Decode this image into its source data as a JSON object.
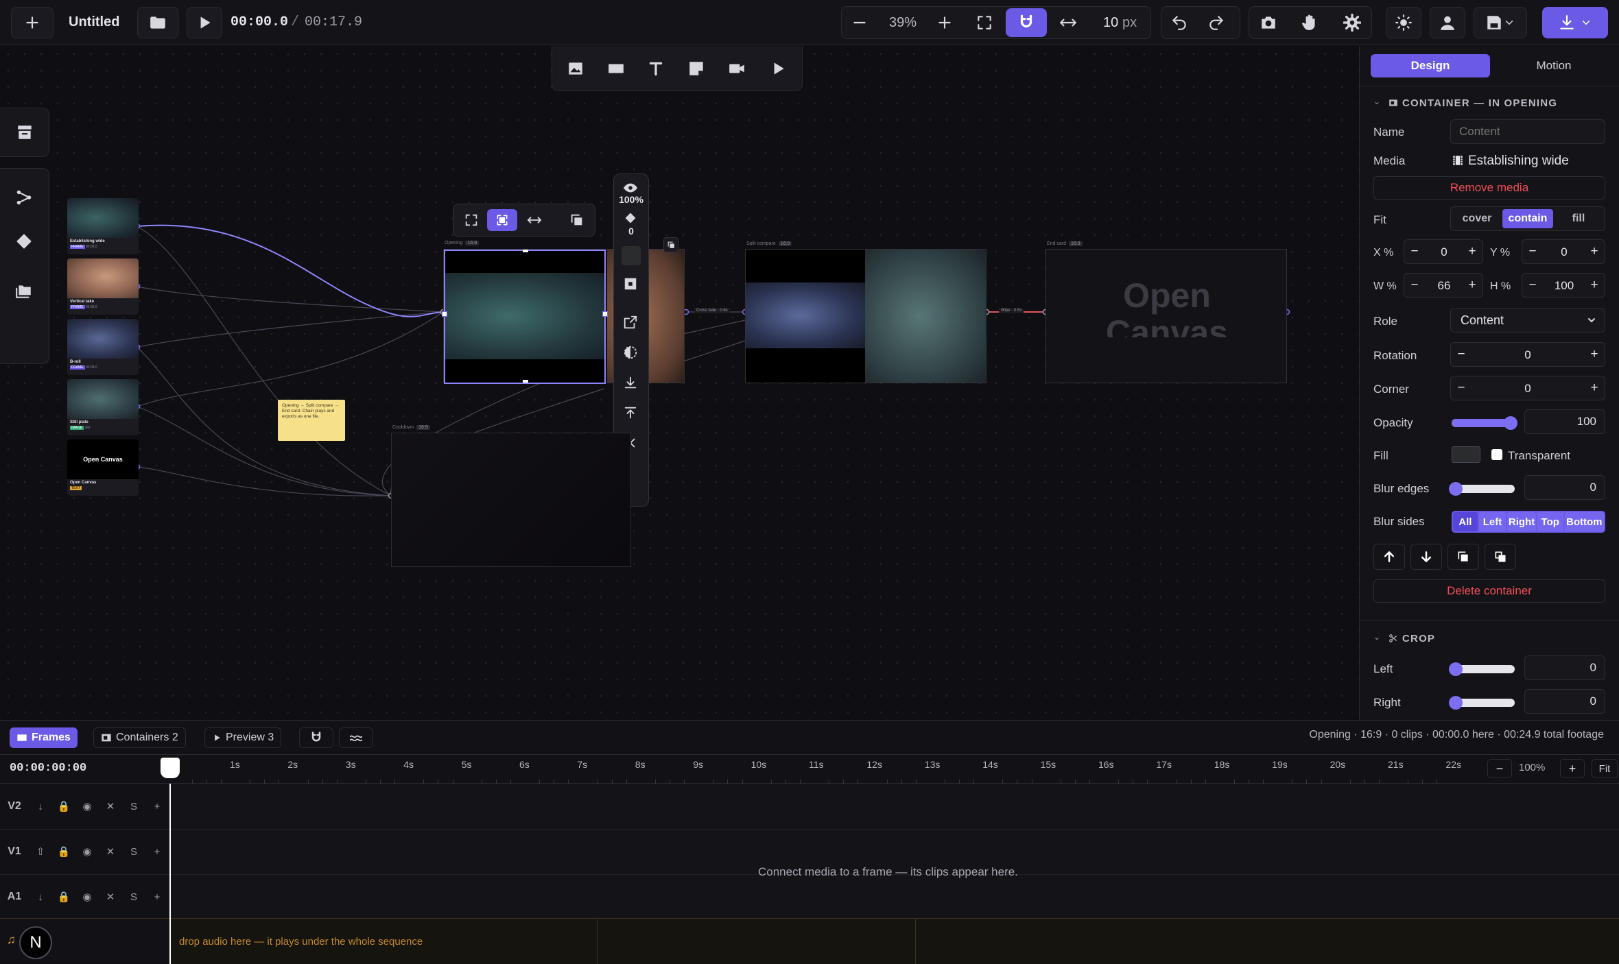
{
  "toolbar": {
    "title": "Untitled",
    "time_current": "00:00.0",
    "time_sep": "/",
    "time_total": "00:17.9",
    "zoom": "39%",
    "snap_value": "10",
    "snap_unit": "px"
  },
  "insertbar": {
    "tools": [
      "image-icon",
      "rectangle-icon",
      "text-icon",
      "note-icon",
      "video-icon",
      "play-icon"
    ]
  },
  "frames": [
    {
      "name": "Establishing wide",
      "badge": "FRAME",
      "meta": "00:08.0"
    },
    {
      "name": "Vertical take",
      "badge": "FRAME",
      "meta": "00:08.0"
    },
    {
      "name": "B-roll",
      "badge": "FRAME",
      "meta": "00:08.0"
    },
    {
      "name": "Still plate",
      "badge": "IMAGE",
      "meta": "still"
    },
    {
      "name": "Open Canvas",
      "badge": "TEXT",
      "meta": "",
      "title": "Open Canvas"
    }
  ],
  "canvas": {
    "opening_label": "Opening",
    "opening_ratio": "16:9",
    "split_label": "Split compare",
    "split_ratio": "16:9",
    "end_label": "End card",
    "end_ratio": "16:9",
    "end_text_1": "Open",
    "end_text_2": "Canvas",
    "cooldown_label": "Cooldown",
    "cooldown_ratio": "16:9",
    "transition_1": "Cross fade · 0.6s",
    "transition_2": "Wipe · 0.5s",
    "note_text": "Opening → Split compare → End card. Chain plays and exports as one file.",
    "side_opacity": "100%",
    "side_keyframes": "0"
  },
  "panel": {
    "tab_design": "Design",
    "tab_motion": "Motion",
    "section_title": "CONTAINER — IN OPENING",
    "name_label": "Name",
    "name_placeholder": "Content",
    "media_label": "Media",
    "media_value": "Establishing wide",
    "remove_media": "Remove media",
    "fit_label": "Fit",
    "fit_options": [
      "cover",
      "contain",
      "fill"
    ],
    "fit_selected": "contain",
    "x_label": "X %",
    "x_value": "0",
    "y_label": "Y %",
    "y_value": "0",
    "w_label": "W %",
    "w_value": "66",
    "h_label": "H %",
    "h_value": "100",
    "role_label": "Role",
    "role_value": "Content",
    "rotation_label": "Rotation",
    "rotation_value": "0",
    "corner_label": "Corner",
    "corner_value": "0",
    "opacity_label": "Opacity",
    "opacity_value": "100",
    "opacity_level": 1.0,
    "fill_label": "Fill",
    "fill_color": "#2a2c2e",
    "transparent_label": "Transparent",
    "blur_edges_label": "Blur edges",
    "blur_edges_value": "0",
    "blur_edges_level": 0,
    "blur_sides_label": "Blur sides",
    "blur_sides": [
      "All",
      "Left",
      "Right",
      "Top",
      "Bottom"
    ],
    "delete_container": "Delete container",
    "crop_title": "CROP",
    "crop_left_label": "Left",
    "crop_left_value": "0",
    "crop_right_label": "Right",
    "crop_right_value": "0"
  },
  "timeline": {
    "tab_frames": "Frames",
    "tab_containers": "Containers 2",
    "tab_preview": "Preview 3",
    "status": "Opening · 16:9 · 0 clips · 00:00.0 here · 00:24.9 total footage",
    "timecode": "00:00:00:00",
    "ticks": [
      "1s",
      "2s",
      "3s",
      "4s",
      "5s",
      "6s",
      "7s",
      "8s",
      "9s",
      "10s",
      "11s",
      "12s",
      "13s",
      "14s",
      "15s",
      "16s",
      "17s",
      "18s",
      "19s",
      "20s",
      "21s",
      "22s"
    ],
    "zoom": "100%",
    "fit": "Fit",
    "tracks": [
      {
        "label": "V2"
      },
      {
        "label": "V1"
      },
      {
        "label": "A1"
      }
    ],
    "track_solo": "S",
    "track_add": "+",
    "empty_message": "Connect media to a frame — its clips appear here.",
    "audio_hint": "drop audio here — it plays under the whole sequence",
    "avatar_letter": "N"
  },
  "colors": {
    "accent": "#7c6ef0",
    "danger": "#f0505a",
    "note": "#f7e08a"
  }
}
